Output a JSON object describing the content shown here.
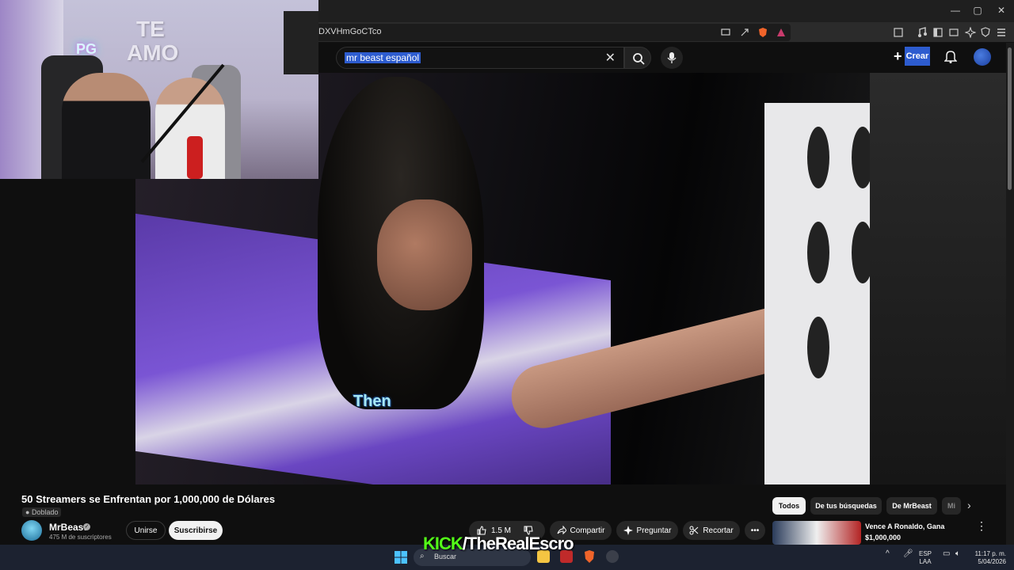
{
  "browser": {
    "url": "DXVHmGoCTco",
    "window_controls": [
      "—",
      "▢",
      "✕"
    ]
  },
  "header": {
    "search_query": "mr beast español",
    "create_label": "Crear"
  },
  "video": {
    "subtitle": "Then"
  },
  "webcam": {
    "neon_sign": "PG",
    "balloon_line1": "TE",
    "balloon_line2": "AMO"
  },
  "info": {
    "title": "50 Streamers se Enfrentan por 1,000,000 de Dólares",
    "dubbed_label": "Doblado",
    "channel_name": "MrBeast",
    "subscribers": "475 M de suscriptores",
    "join_label": "Unirse",
    "subscribe_label": "Suscribirse",
    "likes": "1.5 M",
    "share_label": "Compartir",
    "ask_label": "Preguntar",
    "clip_label": "Recortar"
  },
  "chips": [
    "Todos",
    "De tus búsquedas",
    "De MrBeast",
    "Mi"
  ],
  "recommendation": {
    "title_line1": "Vence A Ronaldo, Gana",
    "title_line2": "$1,000,000"
  },
  "overlay": {
    "kick": "KICK",
    "handle": "/TheRealEscro"
  },
  "taskbar": {
    "search_placeholder": "Buscar",
    "lang1": "ESP",
    "lang2": "LAA",
    "time": "11:17 p. m.",
    "date": "5/04/2026"
  },
  "colors": {
    "accent": "#2d5ccf",
    "kick_green": "#53fc18",
    "subtitle": "#a7e8f4"
  }
}
